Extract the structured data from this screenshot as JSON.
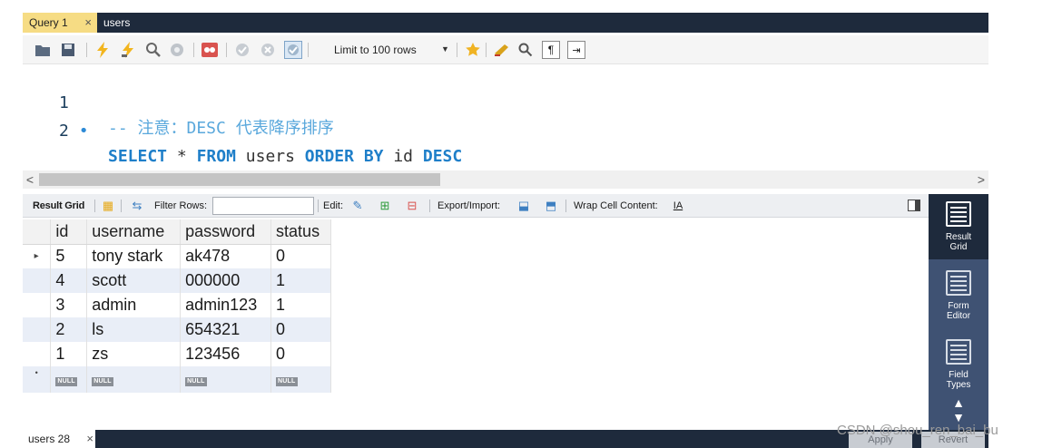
{
  "top_tabs": [
    {
      "label": "Query 1",
      "close": "×"
    },
    {
      "label": "users"
    }
  ],
  "toolbar": {
    "limit_label": "Limit to 100 rows",
    "icons": [
      "open-folder-icon",
      "save-icon",
      "execute-icon",
      "execute-current-icon",
      "explain-icon",
      "stop-icon",
      "toggle-error-icon",
      "commit-icon",
      "rollback-icon",
      "autocommit-icon",
      "bookmark-icon",
      "beautify-icon",
      "find-icon",
      "invisible-chars-icon",
      "wrap-icon"
    ]
  },
  "editor": {
    "lines": [
      {
        "number": "1",
        "comment": "-- 注意：DESC 代表降序排序"
      },
      {
        "number": "2",
        "marker": "•",
        "tokens": [
          "SELECT",
          "*",
          "FROM",
          "users",
          "ORDER BY",
          "id",
          "DESC"
        ]
      }
    ]
  },
  "scrollbar": {
    "left_arrow": "<",
    "right_arrow": ">"
  },
  "result_toolbar": {
    "result_grid": "Result Grid",
    "filter_rows": "Filter Rows:",
    "filter_value": "",
    "edit": "Edit:",
    "export_import": "Export/Import:",
    "wrap_cell": "Wrap Cell Content:"
  },
  "grid": {
    "columns": [
      "id",
      "username",
      "password",
      "status"
    ],
    "rows": [
      {
        "id": "5",
        "username": "tony stark",
        "password": "ak478",
        "status": "0"
      },
      {
        "id": "4",
        "username": "scott",
        "password": "000000",
        "status": "1"
      },
      {
        "id": "3",
        "username": "admin",
        "password": "admin123",
        "status": "1"
      },
      {
        "id": "2",
        "username": "ls",
        "password": "654321",
        "status": "0"
      },
      {
        "id": "1",
        "username": "zs",
        "password": "123456",
        "status": "0"
      }
    ],
    "current_row_marker": "▸",
    "new_row_marker": "•",
    "null_tag": "NULL"
  },
  "side_panel": [
    {
      "label_1": "Result",
      "label_2": "Grid",
      "active": true
    },
    {
      "label_1": "Form",
      "label_2": "Editor",
      "active": false
    },
    {
      "label_1": "Field",
      "label_2": "Types",
      "active": false
    }
  ],
  "bottom": {
    "tab_label": "users 28",
    "tab_close": "×",
    "apply": "Apply",
    "revert": "Revert"
  },
  "watermark": "CSDN @shou_ren_bai_bu",
  "colors": {
    "dark_bar": "#1e2a3c",
    "active_tab": "#f6dc84",
    "keyword": "#1f7fc9",
    "comment": "#5aa8dc",
    "alt_row": "#e9eef7",
    "side_panel": "#3f5273"
  }
}
